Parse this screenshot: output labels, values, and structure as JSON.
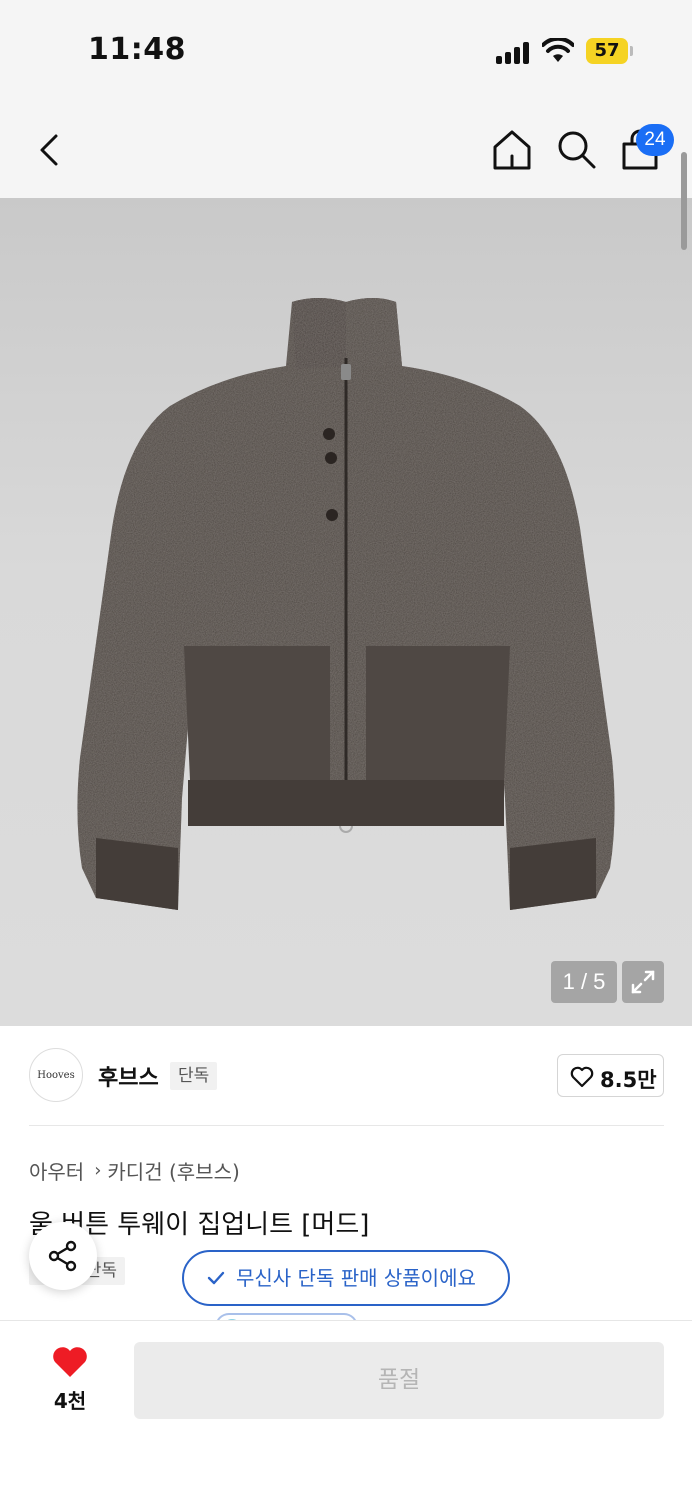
{
  "status_bar": {
    "time": "11:48",
    "battery": "57",
    "icons": [
      "signal-icon",
      "wifi-icon",
      "battery-icon"
    ]
  },
  "top_nav": {
    "icons": [
      "back-icon",
      "home-icon",
      "search-icon",
      "shopping-bag-icon"
    ],
    "cart_badge": "24"
  },
  "gallery": {
    "page_indicator": "1 / 5",
    "current_page": 1,
    "total_pages": 5,
    "garment_color": "#4b4440"
  },
  "brand": {
    "logo_text": "Hooves",
    "name": "후브스",
    "tag": "단독",
    "like_count": "8.5만"
  },
  "product": {
    "breadcrumb": [
      "아우터",
      "카디건 (후브스)"
    ],
    "title": "울 버튼 투웨이 집업니트 [머드]",
    "exclusive_tag": "단독",
    "notice": "무신사 단독 판매 상품이에요"
  },
  "bottom_bar": {
    "wish_count": "4천",
    "buy_label": "품절"
  },
  "colors": {
    "accent_blue": "#2a63c8",
    "badge_blue": "#1a6ef5",
    "heart_red": "#ee1c25",
    "battery_yellow": "#f5d323"
  }
}
